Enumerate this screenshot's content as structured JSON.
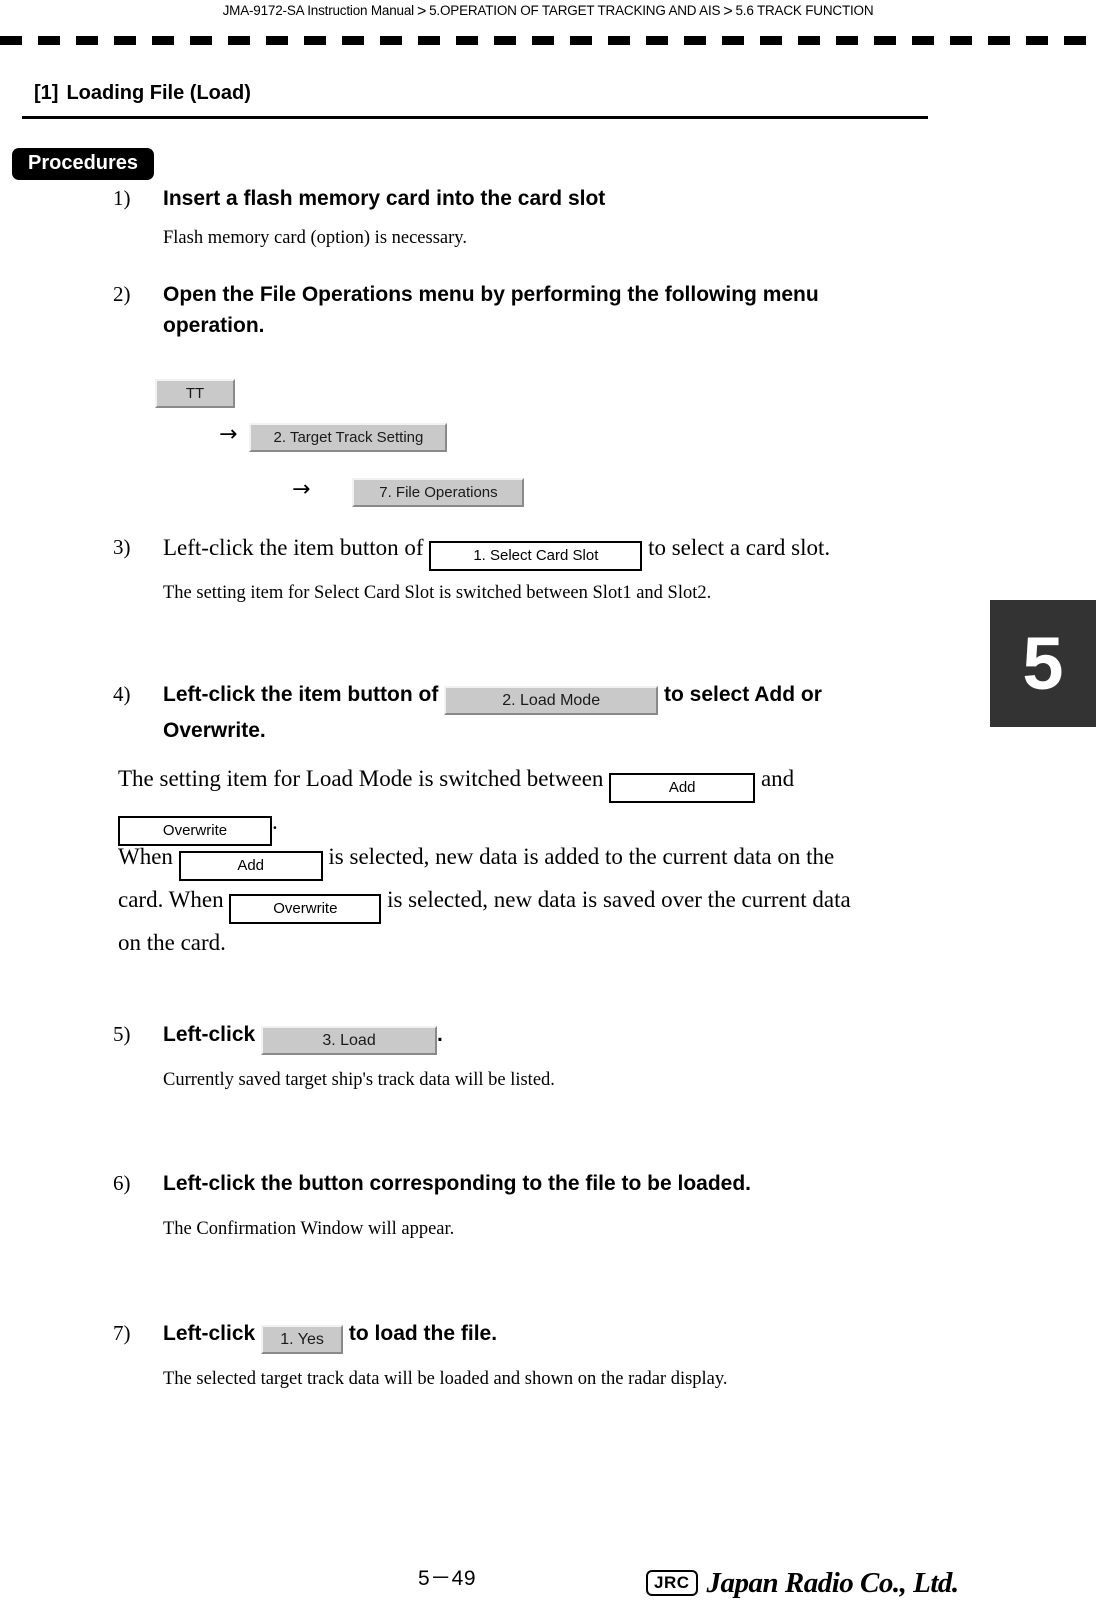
{
  "header": {
    "breadcrumb": [
      "JMA-9172-SA Instruction Manual",
      "5.OPERATION OF TARGET TRACKING AND AIS",
      "5.6  TRACK FUNCTION"
    ],
    "separator": ">"
  },
  "section": {
    "number": "[1]",
    "title": "Loading File (Load)"
  },
  "procedures": {
    "badge_label": "Procedures"
  },
  "steps": {
    "s1": {
      "num": "1)",
      "head": "Insert a flash memory card into the card slot",
      "desc": "Flash memory card (option) is necessary."
    },
    "s2": {
      "num": "2)",
      "head": "Open the File Operations menu by performing the following menu operation."
    },
    "s3": {
      "num": "3)",
      "head_pre": "Left-click the item button of",
      "head_post": "to select a card slot.",
      "button": "1. Select Card Slot",
      "desc": "The setting item for Select Card Slot is switched between Slot1 and Slot2."
    },
    "s4": {
      "num": "4)",
      "head_pre": "Left-click the item button of",
      "head_post": "to select Add or Overwrite.",
      "button": "2.  Load Mode"
    },
    "s5": {
      "num": "5)",
      "head_pre": "Left-click",
      "head_post": ".",
      "button": "3.  Load",
      "desc": "Currently saved target ship's track data will be listed."
    },
    "s6": {
      "num": "6)",
      "head": "Left-click the button corresponding to the file to be loaded.",
      "desc": "The Confirmation Window will appear."
    },
    "s7": {
      "num": "7)",
      "head_pre": "Left-click",
      "head_post": "to load the file.",
      "button": "1. Yes",
      "desc": "The selected target track data will be loaded and shown on the radar display."
    }
  },
  "menu_path": {
    "arrow": "→",
    "level1": "TT",
    "level2": "2. Target Track Setting",
    "level3": "7. File Operations"
  },
  "load_mode": {
    "line1_pre": "The setting item for Load Mode is switched between",
    "line1_mid": "and",
    "line2_post": ".",
    "add": "Add",
    "overwrite": "Overwrite",
    "para2_a": "When",
    "para2_b": "is selected, new data is added to the current data on the",
    "para2_c": "card. When",
    "para2_d": "is selected, new data is saved over the current data",
    "para2_e": "on the card."
  },
  "chapter_tab": {
    "number": "5"
  },
  "footer": {
    "page": "5－49",
    "logo_mark": "JRC",
    "logo_name": "Japan Radio Co., Ltd."
  }
}
